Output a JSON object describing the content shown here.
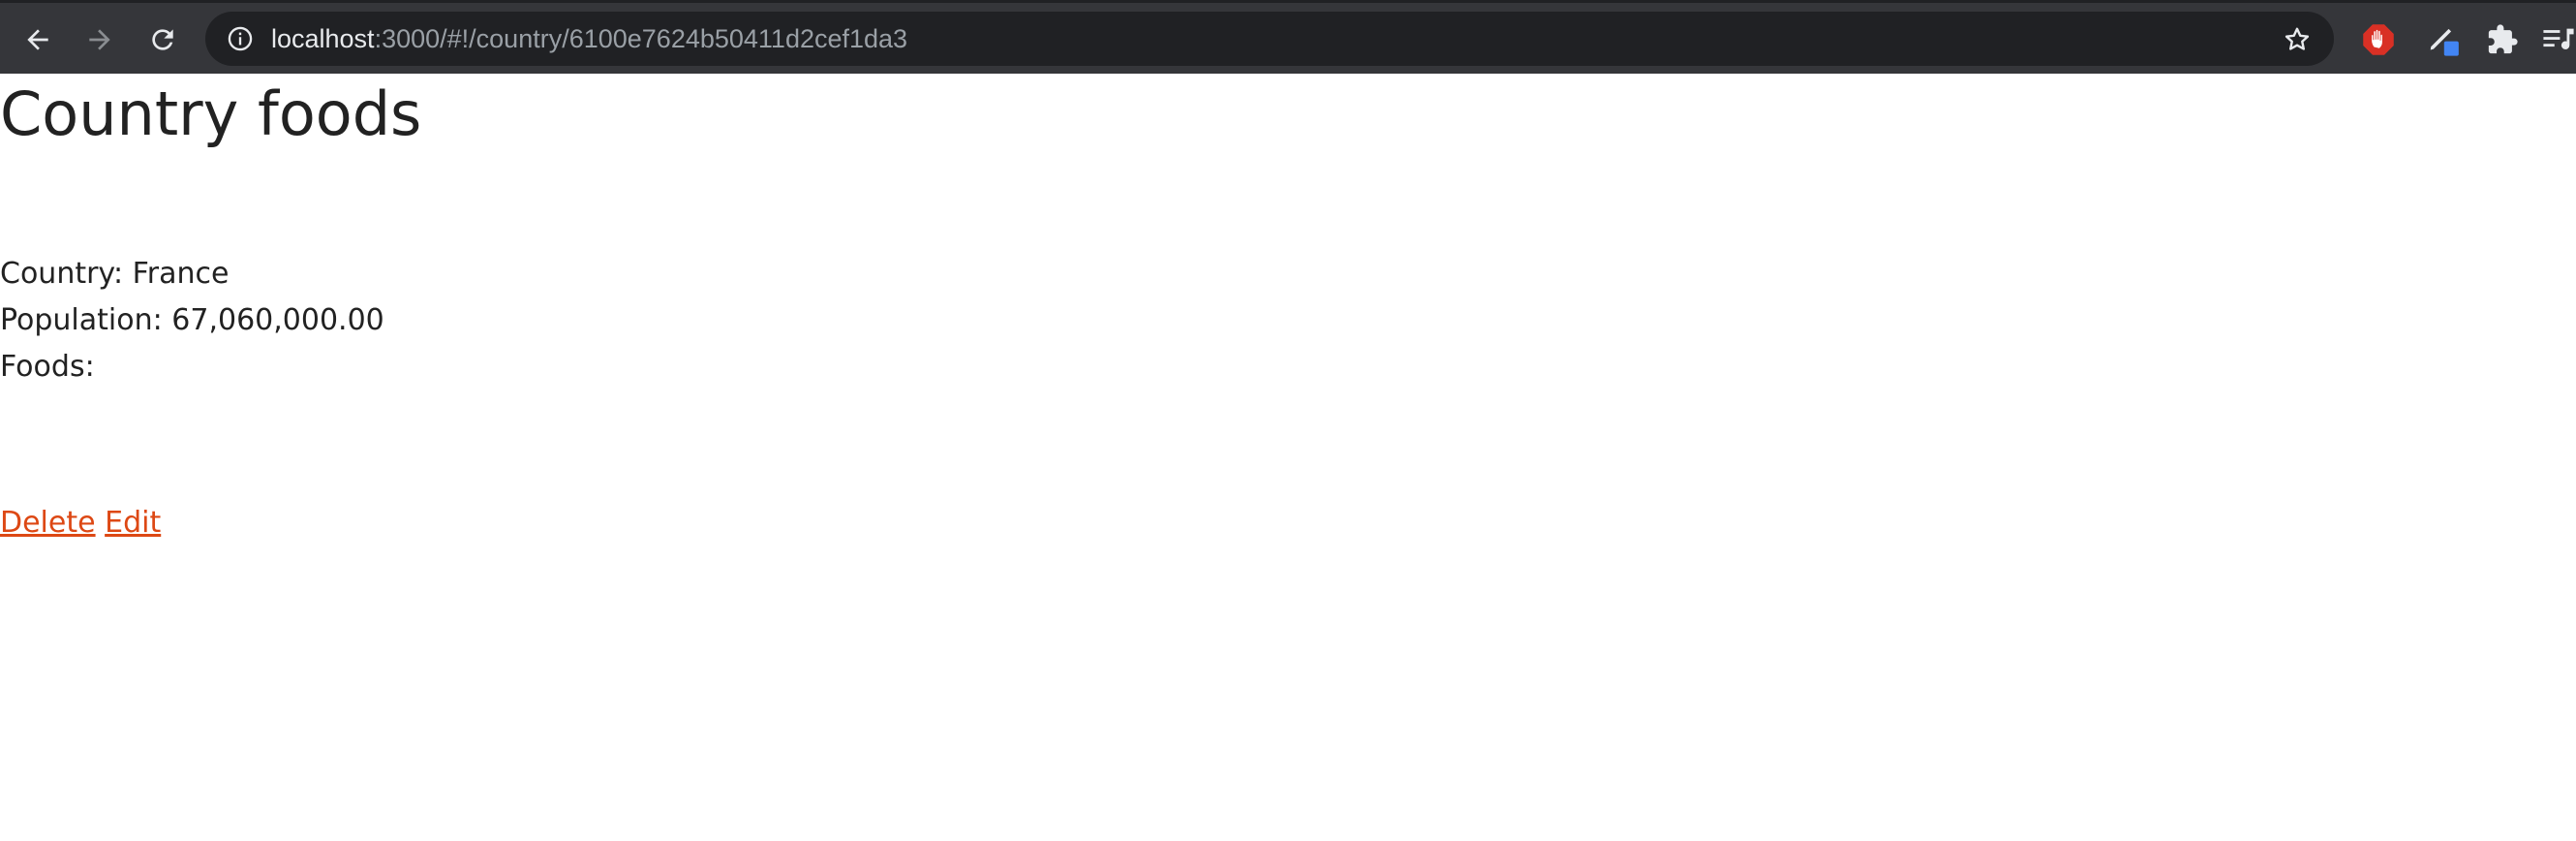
{
  "browser": {
    "url_host": "localhost",
    "url_rest": ":3000/#!/country/6100e7624b50411d2cef1da3",
    "icons": {
      "back": "arrow-left-icon",
      "forward": "arrow-right-icon",
      "reload": "reload-icon",
      "site_info": "info-icon",
      "bookmark": "star-icon",
      "extensions": [
        "adblock-hand-icon",
        "pen-extension-icon",
        "puzzle-icon",
        "media-list-icon"
      ]
    },
    "colors": {
      "toolbar": "#35363a",
      "omnibox": "#202124",
      "adblock": "#d93025",
      "pen_badge": "#4285f4"
    }
  },
  "page": {
    "title": "Country foods",
    "country_label": "Country:",
    "country_value": "France",
    "population_label": "Population:",
    "population_value": "67,060,000.00",
    "foods_label": "Foods:",
    "delete_link": "Delete",
    "edit_link": "Edit",
    "colors": {
      "text": "#222222",
      "link": "#dd4814"
    }
  }
}
